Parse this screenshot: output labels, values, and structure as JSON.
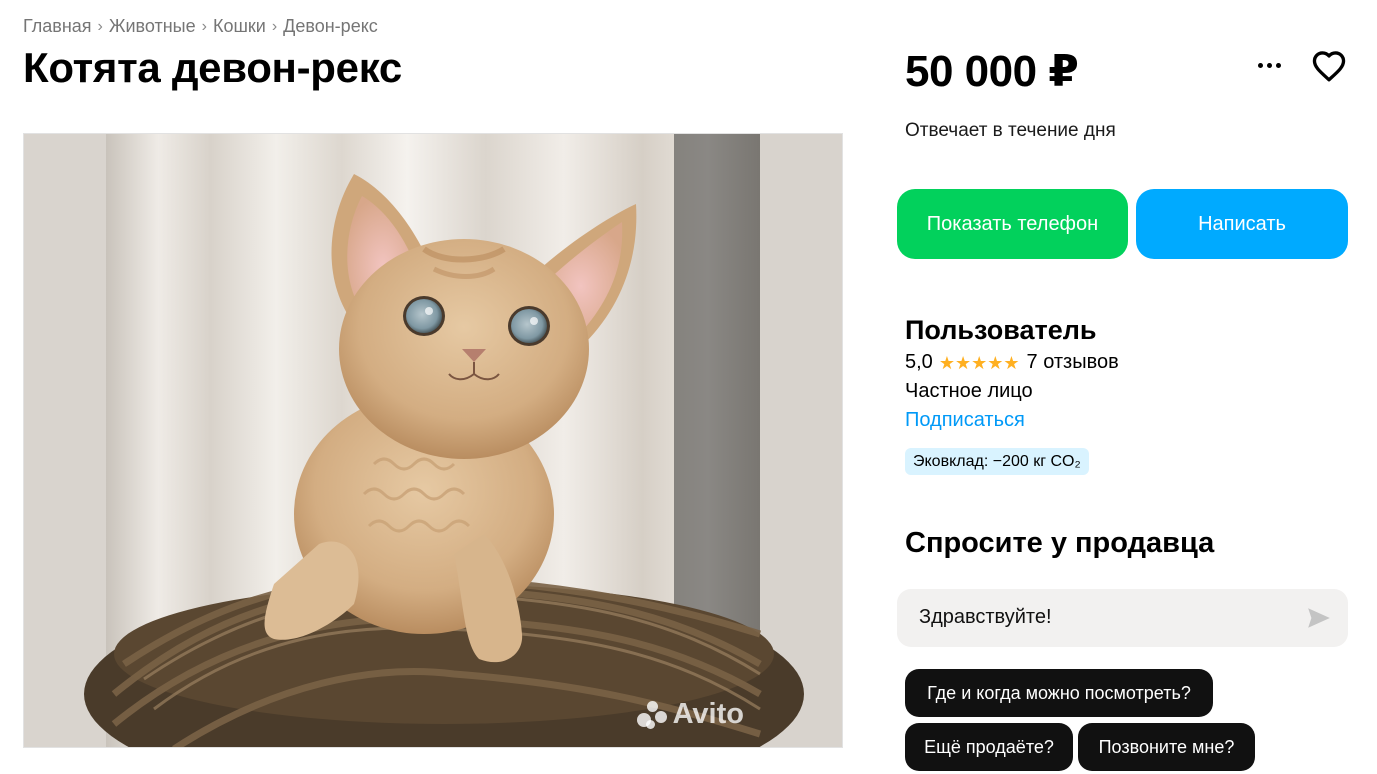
{
  "breadcrumbs": [
    "Главная",
    "Животные",
    "Кошки",
    "Девон-рекс"
  ],
  "breadcrumb_separator": "›",
  "listing": {
    "title": "Котята девон-рекс",
    "price": "50 000 ₽",
    "photo_watermark": "Avito"
  },
  "actions": {
    "more_icon": "more-dots-icon",
    "favorite_icon": "heart-icon"
  },
  "responds_text": "Отвечает в течение дня",
  "buttons": {
    "show_phone": "Показать телефон",
    "write": "Написать"
  },
  "colors": {
    "show_phone_bg": "#02d15c",
    "write_bg": "#00aaff",
    "star": "#ffb021",
    "link": "#0099f7",
    "eco_badge_bg": "#d9f3ff",
    "chip_bg": "#111111"
  },
  "seller": {
    "name": "Пользователь",
    "rating": "5,0",
    "stars": 5,
    "reviews": "7 отзывов",
    "type": "Частное лицо",
    "subscribe": "Подписаться",
    "eco_badge": "Эковклад: −200 кг CO₂"
  },
  "ask": {
    "title": "Спросите у продавца",
    "message": "Здравствуйте!",
    "send_icon": "send-icon",
    "quick_questions": [
      "Где и когда можно посмотреть?",
      "Ещё продаёте?",
      "Позвоните мне?"
    ]
  }
}
